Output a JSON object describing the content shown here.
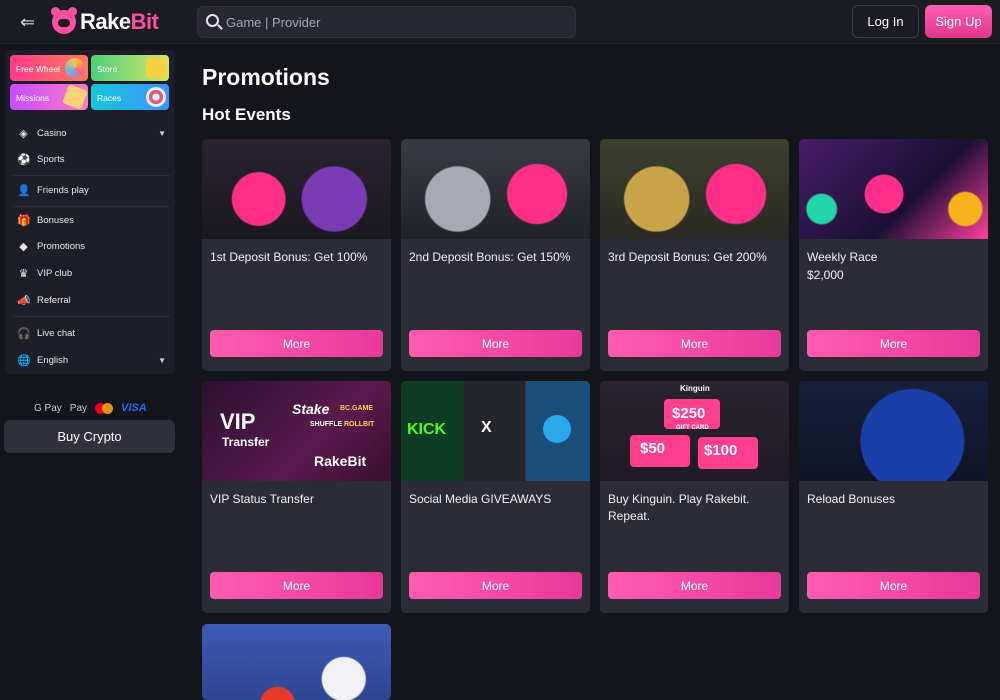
{
  "header": {
    "logo_text_a": "Rake",
    "logo_text_b": "Bit",
    "search_placeholder": "Game | Provider",
    "login_label": "Log In",
    "signup_label": "Sign Up"
  },
  "sidebar": {
    "promos": [
      {
        "label": "Free Wheel"
      },
      {
        "label": "Store"
      },
      {
        "label": "Missions"
      },
      {
        "label": "Races"
      }
    ],
    "items": [
      {
        "label": "Casino",
        "icon": "cube-icon"
      },
      {
        "label": "Sports",
        "icon": "ball-icon"
      },
      {
        "label": "Friends play",
        "icon": "friends-icon"
      },
      {
        "label": "Bonuses",
        "icon": "gift-icon"
      },
      {
        "label": "Promotions",
        "icon": "promo-icon"
      },
      {
        "label": "VIP club",
        "icon": "crown-icon"
      },
      {
        "label": "Referral",
        "icon": "megaphone-icon"
      },
      {
        "label": "Live chat",
        "icon": "headset-icon"
      },
      {
        "label": "English",
        "icon": "globe-icon"
      }
    ],
    "payments": {
      "gpay": "G Pay",
      "applepay": "Pay",
      "visa": "VISA"
    },
    "buy_crypto_label": "Buy Crypto"
  },
  "main": {
    "page_title": "Promotions",
    "section_title": "Hot Events",
    "cards": [
      {
        "title": "1st Deposit Bonus: Get 100%",
        "sub": "",
        "button": "More"
      },
      {
        "title": "2nd Deposit Bonus: Get 150%",
        "sub": "",
        "button": "More"
      },
      {
        "title": "3rd Deposit Bonus: Get 200%",
        "sub": "",
        "button": "More"
      },
      {
        "title": "Weekly Race",
        "sub": "$2,000",
        "button": "More"
      },
      {
        "title": "VIP Status Transfer",
        "sub": "",
        "button": "More"
      },
      {
        "title": "Social Media GIVEAWAYS",
        "sub": "",
        "button": "More"
      },
      {
        "title": "Buy Kinguin. Play Rakebit. Repeat.",
        "sub": "",
        "button": "More"
      },
      {
        "title": "Reload Bonuses",
        "sub": "",
        "button": "More"
      }
    ],
    "card_images": {
      "vip_big": "VIP",
      "vip_small": "Transfer",
      "vip_stake": "Stake",
      "vip_bc": "BC.GAME",
      "vip_shuffle": "SHUFFLE",
      "vip_rollbit": "ROLLBIT",
      "vip_logo": "RakeBit",
      "kick": "KICK",
      "x": "X",
      "kinguin": "Kinguin",
      "k250": "$250",
      "k50": "$50",
      "k100": "$100",
      "giftcard": "GIFT CARD"
    }
  },
  "colors": {
    "accent": "#ff4fa0",
    "bg": "#14151c",
    "card": "#2b2c37"
  }
}
